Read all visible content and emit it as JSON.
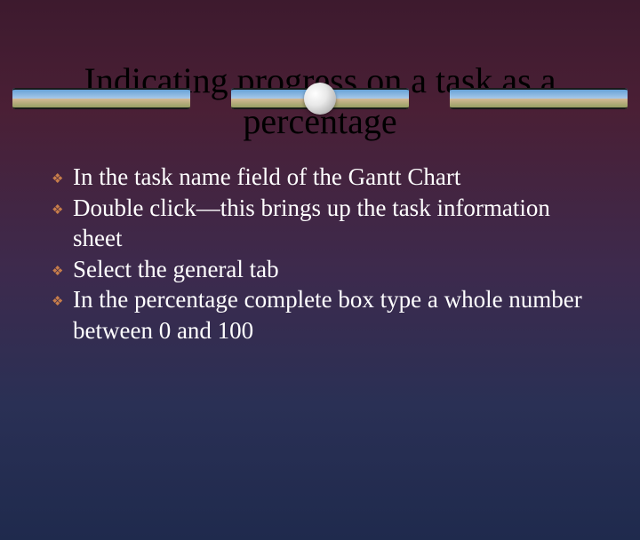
{
  "title": "Indicating progress on a task as a percentage",
  "bullets": [
    "In the task name field of the Gantt Chart",
    "Double click—this brings up the task information sheet",
    "Select the general tab",
    "In the percentage complete box type a whole number between 0 and 100"
  ],
  "bullet_glyph": "❖"
}
